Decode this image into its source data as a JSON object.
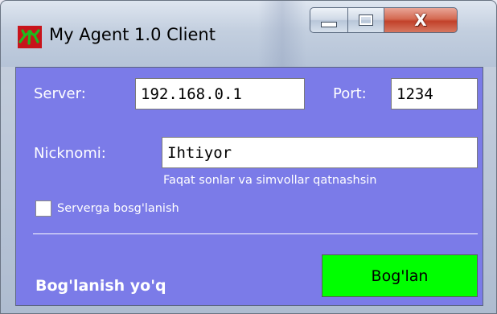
{
  "window": {
    "title": "My Agent 1.0 Client",
    "app_icon": "my-agent-app-icon",
    "controls": {
      "minimize": "minimize-icon",
      "maximize": "maximize-icon",
      "close_glyph": "X"
    }
  },
  "form": {
    "server_label": "Server:",
    "server_value": "192.168.0.1",
    "port_label": "Port:",
    "port_value": "1234",
    "nickname_label": "Nicknomi:",
    "nickname_value": "Ihtiyor",
    "nickname_hint": "Faqat sonlar va simvollar qatnashsin",
    "auto_connect_label": "Serverga bosg'lanish",
    "auto_connect_checked": false
  },
  "status_text": "Bog'lanish yo'q",
  "connect_button_label": "Bog'lan",
  "colors": {
    "client_background": "#7b7be8",
    "connect_button": "#00ff00",
    "label_text": "#ffffff"
  }
}
